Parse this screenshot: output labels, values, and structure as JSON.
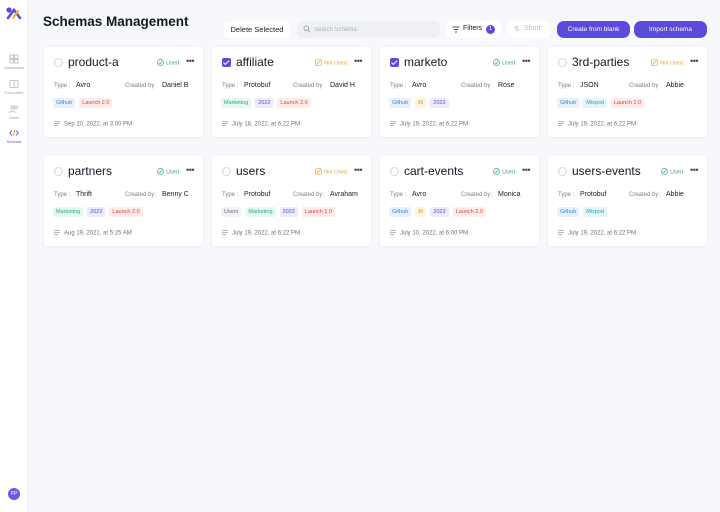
{
  "app": {
    "title": "Schemas Management",
    "nav": [
      {
        "label": "Dashboard",
        "icon": "dashboard-icon"
      },
      {
        "label": "Favourites",
        "icon": "book-icon"
      },
      {
        "label": "Users",
        "icon": "users-icon"
      },
      {
        "label": "Schema",
        "icon": "code-icon"
      }
    ],
    "user_initials": "PP"
  },
  "toolbar": {
    "delete_label": "Delete Selected",
    "search_placeholder": "Search Schema",
    "filters_label": "Filters",
    "filters_count": "1",
    "sort_label": "Short",
    "create_label": "Create from blank",
    "import_label": "Import schema"
  },
  "labels": {
    "type": "Type :",
    "created_by": "Created by :"
  },
  "tag_colors": {
    "Github": {
      "bg": "#e6f1fd",
      "fg": "#3b82d6"
    },
    "Launch 2.0": {
      "bg": "#fdecea",
      "fg": "#d0493f"
    },
    "Launch 1.0": {
      "bg": "#fdecea",
      "fg": "#d0493f"
    },
    "Marketing": {
      "bg": "#e5f8f3",
      "fg": "#2aa77f"
    },
    "2022": {
      "bg": "#ecebfc",
      "fg": "#5b4bdb"
    },
    "BI": {
      "bg": "#fdf5df",
      "fg": "#d79b24"
    },
    "Mixpod": {
      "bg": "#e3f5f8",
      "fg": "#2e9cb2"
    },
    "Users": {
      "bg": "#f1f2f4",
      "fg": "#666c78"
    }
  },
  "schemas": [
    {
      "name": "product-a",
      "status": "Used",
      "type": "Avro",
      "created_by": "Daniel B",
      "tags": [
        "Github",
        "Launch 2.0"
      ],
      "date": "Sep 20, 2022, at 3:00 PM",
      "selected": false
    },
    {
      "name": "affiliate",
      "status": "Not Used",
      "type": "Protobuf",
      "created_by": "David H",
      "tags": [
        "Marketing",
        "2022",
        "Launch 2.0"
      ],
      "date": "July 18, 2022, at 6:22 PM",
      "selected": true
    },
    {
      "name": "marketo",
      "status": "Used",
      "type": "Avro",
      "created_by": "Rose",
      "tags": [
        "Github",
        "BI",
        "2022"
      ],
      "date": "July 19, 2022, at 6:22 PM",
      "selected": true
    },
    {
      "name": "3rd-parties",
      "status": "Not Used",
      "type": "JSON",
      "created_by": "Abbie",
      "tags": [
        "Github",
        "Mixpod",
        "Launch 2.0"
      ],
      "date": "July 19, 2022, at 6:22 PM",
      "selected": false
    },
    {
      "name": "partners",
      "status": "Used",
      "type": "Thrift",
      "created_by": "Benny C",
      "tags": [
        "Marketing",
        "2022",
        "Launch 2.0"
      ],
      "date": "Aug 19, 2021, at 5:25 AM",
      "selected": false
    },
    {
      "name": "users",
      "status": "Not Used",
      "type": "Protobuf",
      "created_by": "Avraham",
      "tags": [
        "Users",
        "Marketing",
        "2022",
        "Launch 1.0"
      ],
      "date": "July 19, 2022, at 6:22 PM",
      "selected": false
    },
    {
      "name": "cart-events",
      "status": "Used",
      "type": "Avro",
      "created_by": "Monica",
      "tags": [
        "Github",
        "BI",
        "2022",
        "Launch 2.0"
      ],
      "date": "July 10, 2022, at 6:00 PM",
      "selected": false
    },
    {
      "name": "users-events",
      "status": "Used",
      "type": "Protobuf",
      "created_by": "Abbie",
      "tags": [
        "Github",
        "Mixpod"
      ],
      "date": "July 19, 2022, at 6:22 PM",
      "selected": false
    }
  ]
}
